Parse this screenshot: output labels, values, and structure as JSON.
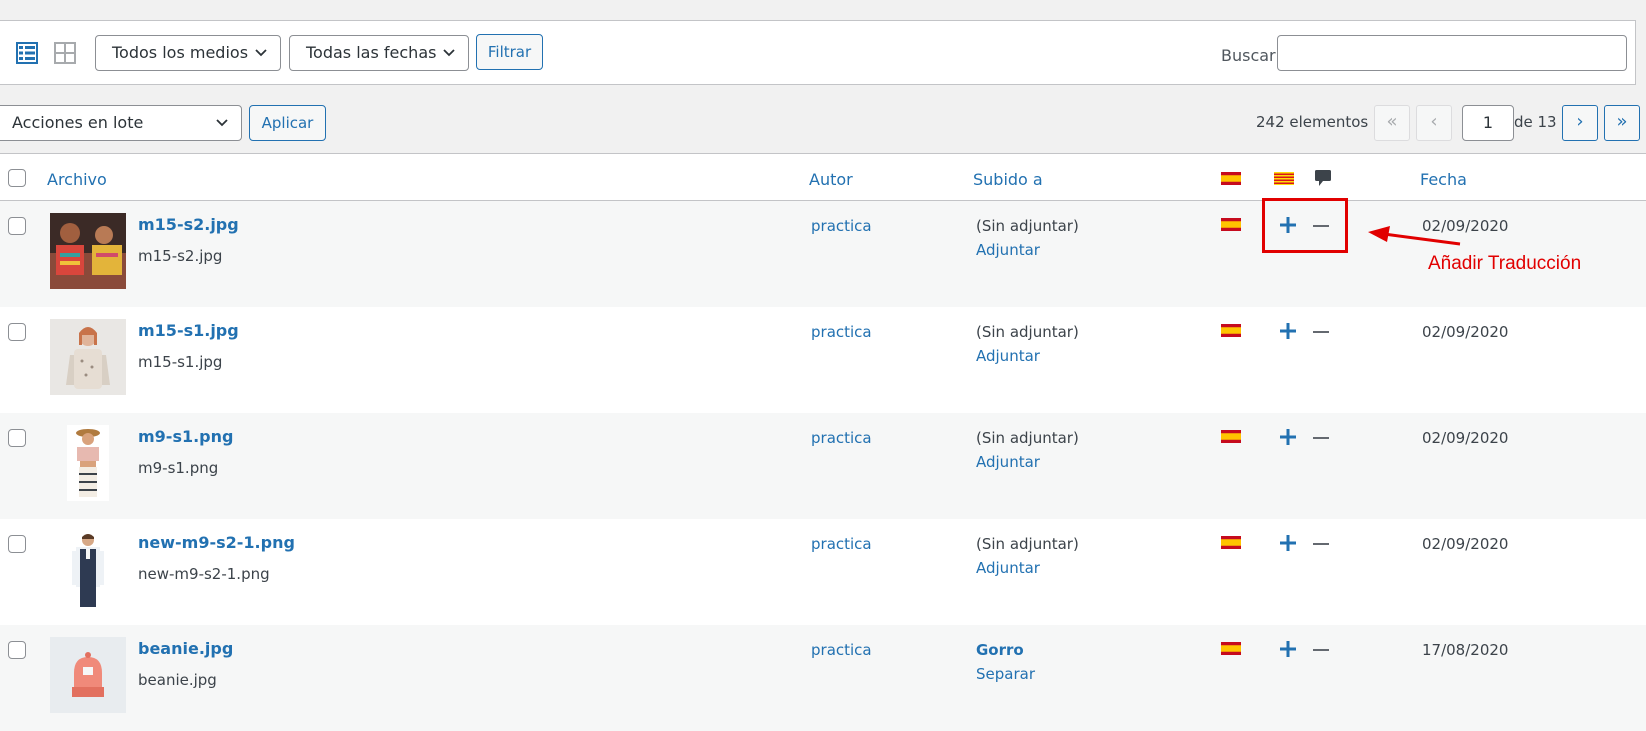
{
  "toolbar": {
    "media_filter": "Todos los medios",
    "date_filter": "Todas las fechas",
    "filter_button": "Filtrar",
    "search_label": "Buscar",
    "search_value": ""
  },
  "bulk": {
    "actions_label": "Acciones en lote",
    "apply_button": "Aplicar"
  },
  "pagination": {
    "count": "242 elementos",
    "first": "«",
    "prev": "‹",
    "current_page": "1",
    "of_total": "de 13",
    "next": "›",
    "last": "»"
  },
  "columns": {
    "file": "Archivo",
    "author": "Autor",
    "uploaded_to": "Subido a",
    "date": "Fecha"
  },
  "rows": [
    {
      "title": "m15-s2.jpg",
      "filename": "m15-s2.jpg",
      "author": "practica",
      "attached": "(Sin adjuntar)",
      "action": "Adjuntar",
      "date": "02/09/2020"
    },
    {
      "title": "m15-s1.jpg",
      "filename": "m15-s1.jpg",
      "author": "practica",
      "attached": "(Sin adjuntar)",
      "action": "Adjuntar",
      "date": "02/09/2020"
    },
    {
      "title": "m9-s1.png",
      "filename": "m9-s1.png",
      "author": "practica",
      "attached": "(Sin adjuntar)",
      "action": "Adjuntar",
      "date": "02/09/2020"
    },
    {
      "title": "new-m9-s2-1.png",
      "filename": "new-m9-s2-1.png",
      "author": "practica",
      "attached": "(Sin adjuntar)",
      "action": "Adjuntar",
      "date": "02/09/2020"
    },
    {
      "title": "beanie.jpg",
      "filename": "beanie.jpg",
      "author": "practica",
      "attached": "Gorro",
      "action": "Separar",
      "date": "17/08/2020"
    }
  ],
  "annotation": {
    "text": "Añadir Traducción",
    "color": "#e10000"
  },
  "colors": {
    "link": "#2271b1",
    "text": "#3c434a",
    "background": "#f1f1f1"
  },
  "icons": {
    "list_view": "list-view-icon",
    "grid_view": "grid-view-icon",
    "flag_es": "flag-spain-icon",
    "flag_ca": "flag-catalonia-icon",
    "comments": "comment-bubble-icon",
    "add_translation": "plus-icon"
  }
}
